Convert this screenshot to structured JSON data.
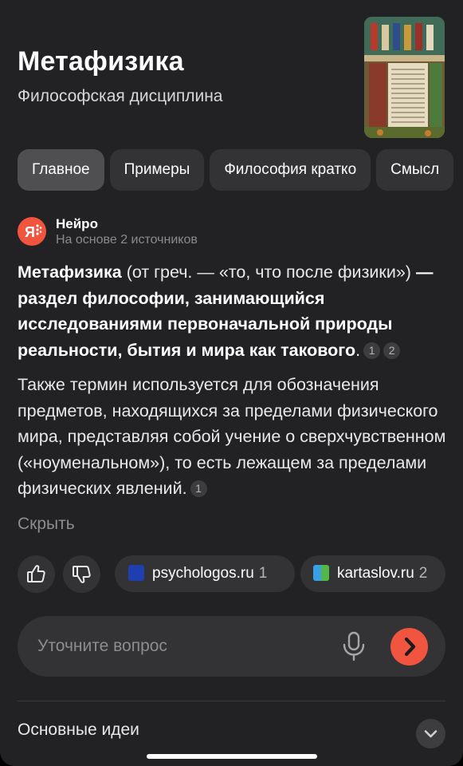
{
  "header": {
    "title": "Метафизика",
    "subtitle": "Философская дисциплина"
  },
  "tabs": [
    {
      "label": "Главное",
      "active": true
    },
    {
      "label": "Примеры",
      "active": false
    },
    {
      "label": "Философия кратко",
      "active": false
    },
    {
      "label": "Смысл",
      "active": false
    }
  ],
  "neuro": {
    "name": "Нейро",
    "sources_caption": "На основе 2 источников",
    "logo_icon": "yandex-neuro-logo"
  },
  "answer": {
    "p1_term": "Метафизика",
    "p1_plain": " (от греч. — «то, что после физики») ",
    "p1_bold": "— раздел философии, занимающийся исследованиями первоначальной природы реальности, бытия и мира как такового",
    "p1_end": ".",
    "p1_citations": [
      "1",
      "2"
    ],
    "p2_text": "Также термин используется для обозначения предметов, находящихся за пределами физического мира, представляя собой учение о сверхчувственном («ноуменальном»), то есть лежащем за пределами физических явлений.",
    "p2_citations": [
      "1"
    ],
    "hide_label": "Скрыть"
  },
  "feedback": {
    "like_icon": "thumbs-up-icon",
    "dislike_icon": "thumbs-down-icon"
  },
  "sources": [
    {
      "domain": "psychologos.ru",
      "count": "1",
      "icon": "psychologos-favicon"
    },
    {
      "domain": "kartaslov.ru",
      "count": "2",
      "icon": "kartaslov-favicon"
    }
  ],
  "query_input": {
    "placeholder": "Уточните вопрос",
    "mic_icon": "microphone-icon",
    "send_icon": "chevron-right-icon"
  },
  "section": {
    "title": "Основные идеи",
    "icon": "chevron-down-icon"
  },
  "colors": {
    "background": "#222224",
    "surface": "#333336",
    "accent": "#f2553f",
    "muted_text": "#8d8d90"
  }
}
